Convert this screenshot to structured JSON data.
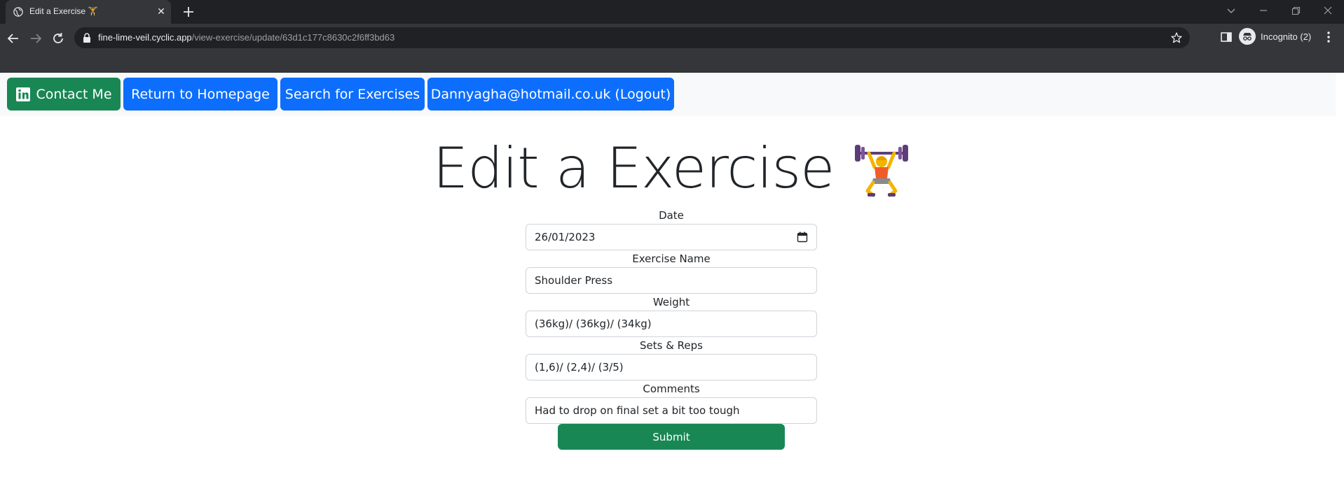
{
  "browser": {
    "tab": {
      "title": "Edit a Exercise 🏋️",
      "favicon": "globe-icon"
    },
    "new_tab_label": "+",
    "address": {
      "host": "fine-lime-veil.cyclic.app",
      "path": "/view-exercise/update/63d1c177c8630c2f6ff3bd63"
    },
    "profile": {
      "label": "Incognito (2)"
    }
  },
  "nav": {
    "contact_label": "Contact Me",
    "home_label": "Return to Homepage",
    "search_label": "Search for Exercises",
    "logout_label": "Dannyagha@hotmail.co.uk (Logout)"
  },
  "page": {
    "heading": "Edit a Exercise",
    "heading_emoji": "weightlifter-icon"
  },
  "form": {
    "date": {
      "label": "Date",
      "value": "26/01/2023"
    },
    "exercise_name": {
      "label": "Exercise Name",
      "value": "Shoulder Press"
    },
    "weight": {
      "label": "Weight",
      "value": "(36kg)/ (36kg)/ (34kg)"
    },
    "sets_reps": {
      "label": "Sets & Reps",
      "value": "(1,6)/ (2,4)/ (3/5)"
    },
    "comments": {
      "label": "Comments",
      "value": "Had to drop on final set a bit too tough"
    },
    "submit_label": "Submit"
  },
  "colors": {
    "primary": "#0d6efd",
    "success": "#198754",
    "chrome_dark": "#202124",
    "chrome_toolbar": "#35363a"
  }
}
